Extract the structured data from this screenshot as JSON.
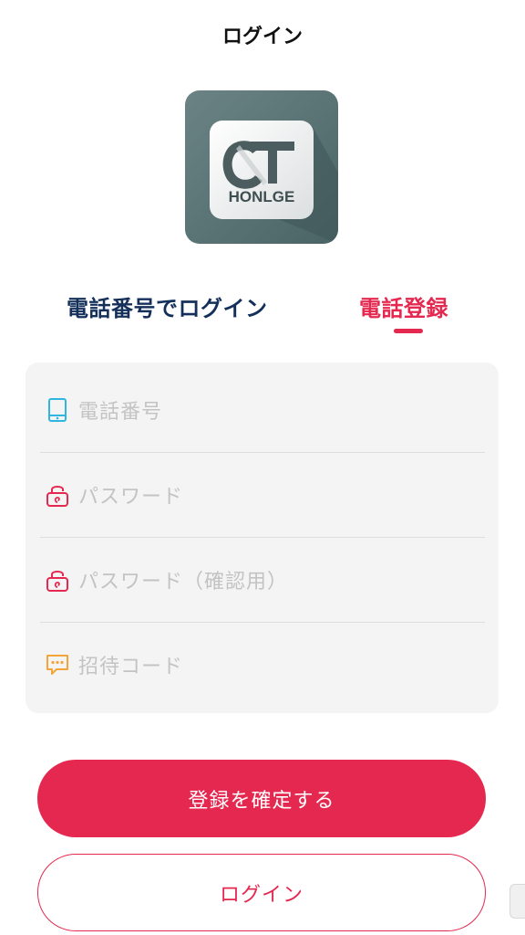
{
  "header": {
    "title": "ログイン"
  },
  "logo": {
    "brand_mark": "CT",
    "brand_text": "HONLGE"
  },
  "tabs": [
    {
      "label": "電話番号でログイン",
      "active": false
    },
    {
      "label": "電話登録",
      "active": true
    }
  ],
  "form": {
    "fields": [
      {
        "icon": "phone-icon",
        "placeholder": "電話番号"
      },
      {
        "icon": "lock-icon",
        "placeholder": "パスワード"
      },
      {
        "icon": "lock-icon",
        "placeholder": "パスワード（確認用）"
      },
      {
        "icon": "message-icon",
        "placeholder": "招待コード"
      }
    ]
  },
  "buttons": {
    "confirm_register": "登録を確定する",
    "login": "ログイン"
  },
  "colors": {
    "accent": "#e5284f",
    "tab_inactive": "#14305a",
    "card_bg": "#f4f4f4",
    "placeholder": "#c3c3c3",
    "phone_icon": "#2fb6e0",
    "lock_icon": "#e5284f",
    "message_icon": "#f3a53a"
  }
}
